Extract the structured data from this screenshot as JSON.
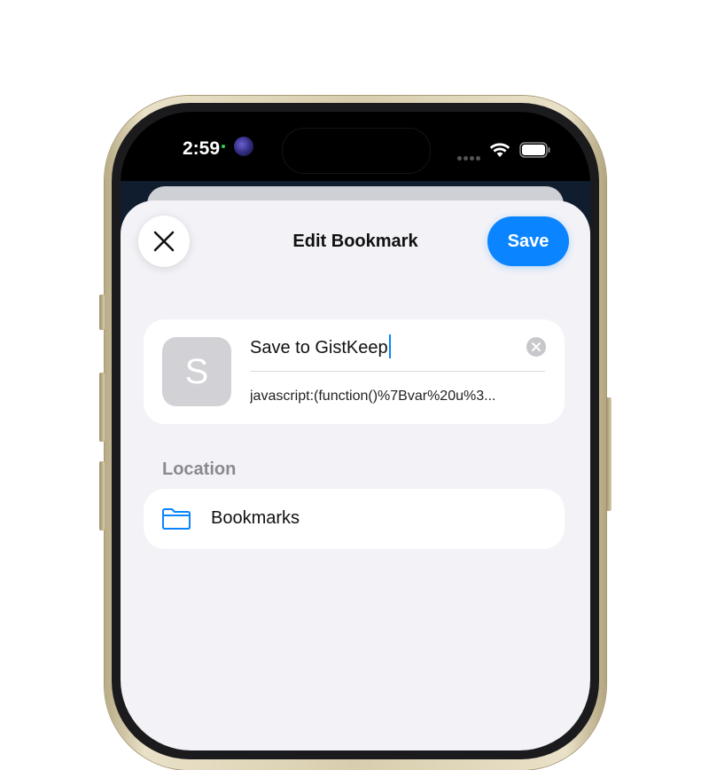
{
  "status_bar": {
    "time": "2:59"
  },
  "sheet": {
    "title": "Edit Bookmark",
    "close_icon": "close-icon",
    "save_label": "Save"
  },
  "bookmark": {
    "favicon_letter": "S",
    "title": "Save to GistKeep",
    "url": "javascript:(function()%7Bvar%20u%3..."
  },
  "location": {
    "header": "Location",
    "folder": "Bookmarks",
    "folder_icon": "folder-icon"
  },
  "colors": {
    "accent": "#0a84ff",
    "sheet_background": "#f2f2f7",
    "secondary_text": "#8a8a8e"
  }
}
